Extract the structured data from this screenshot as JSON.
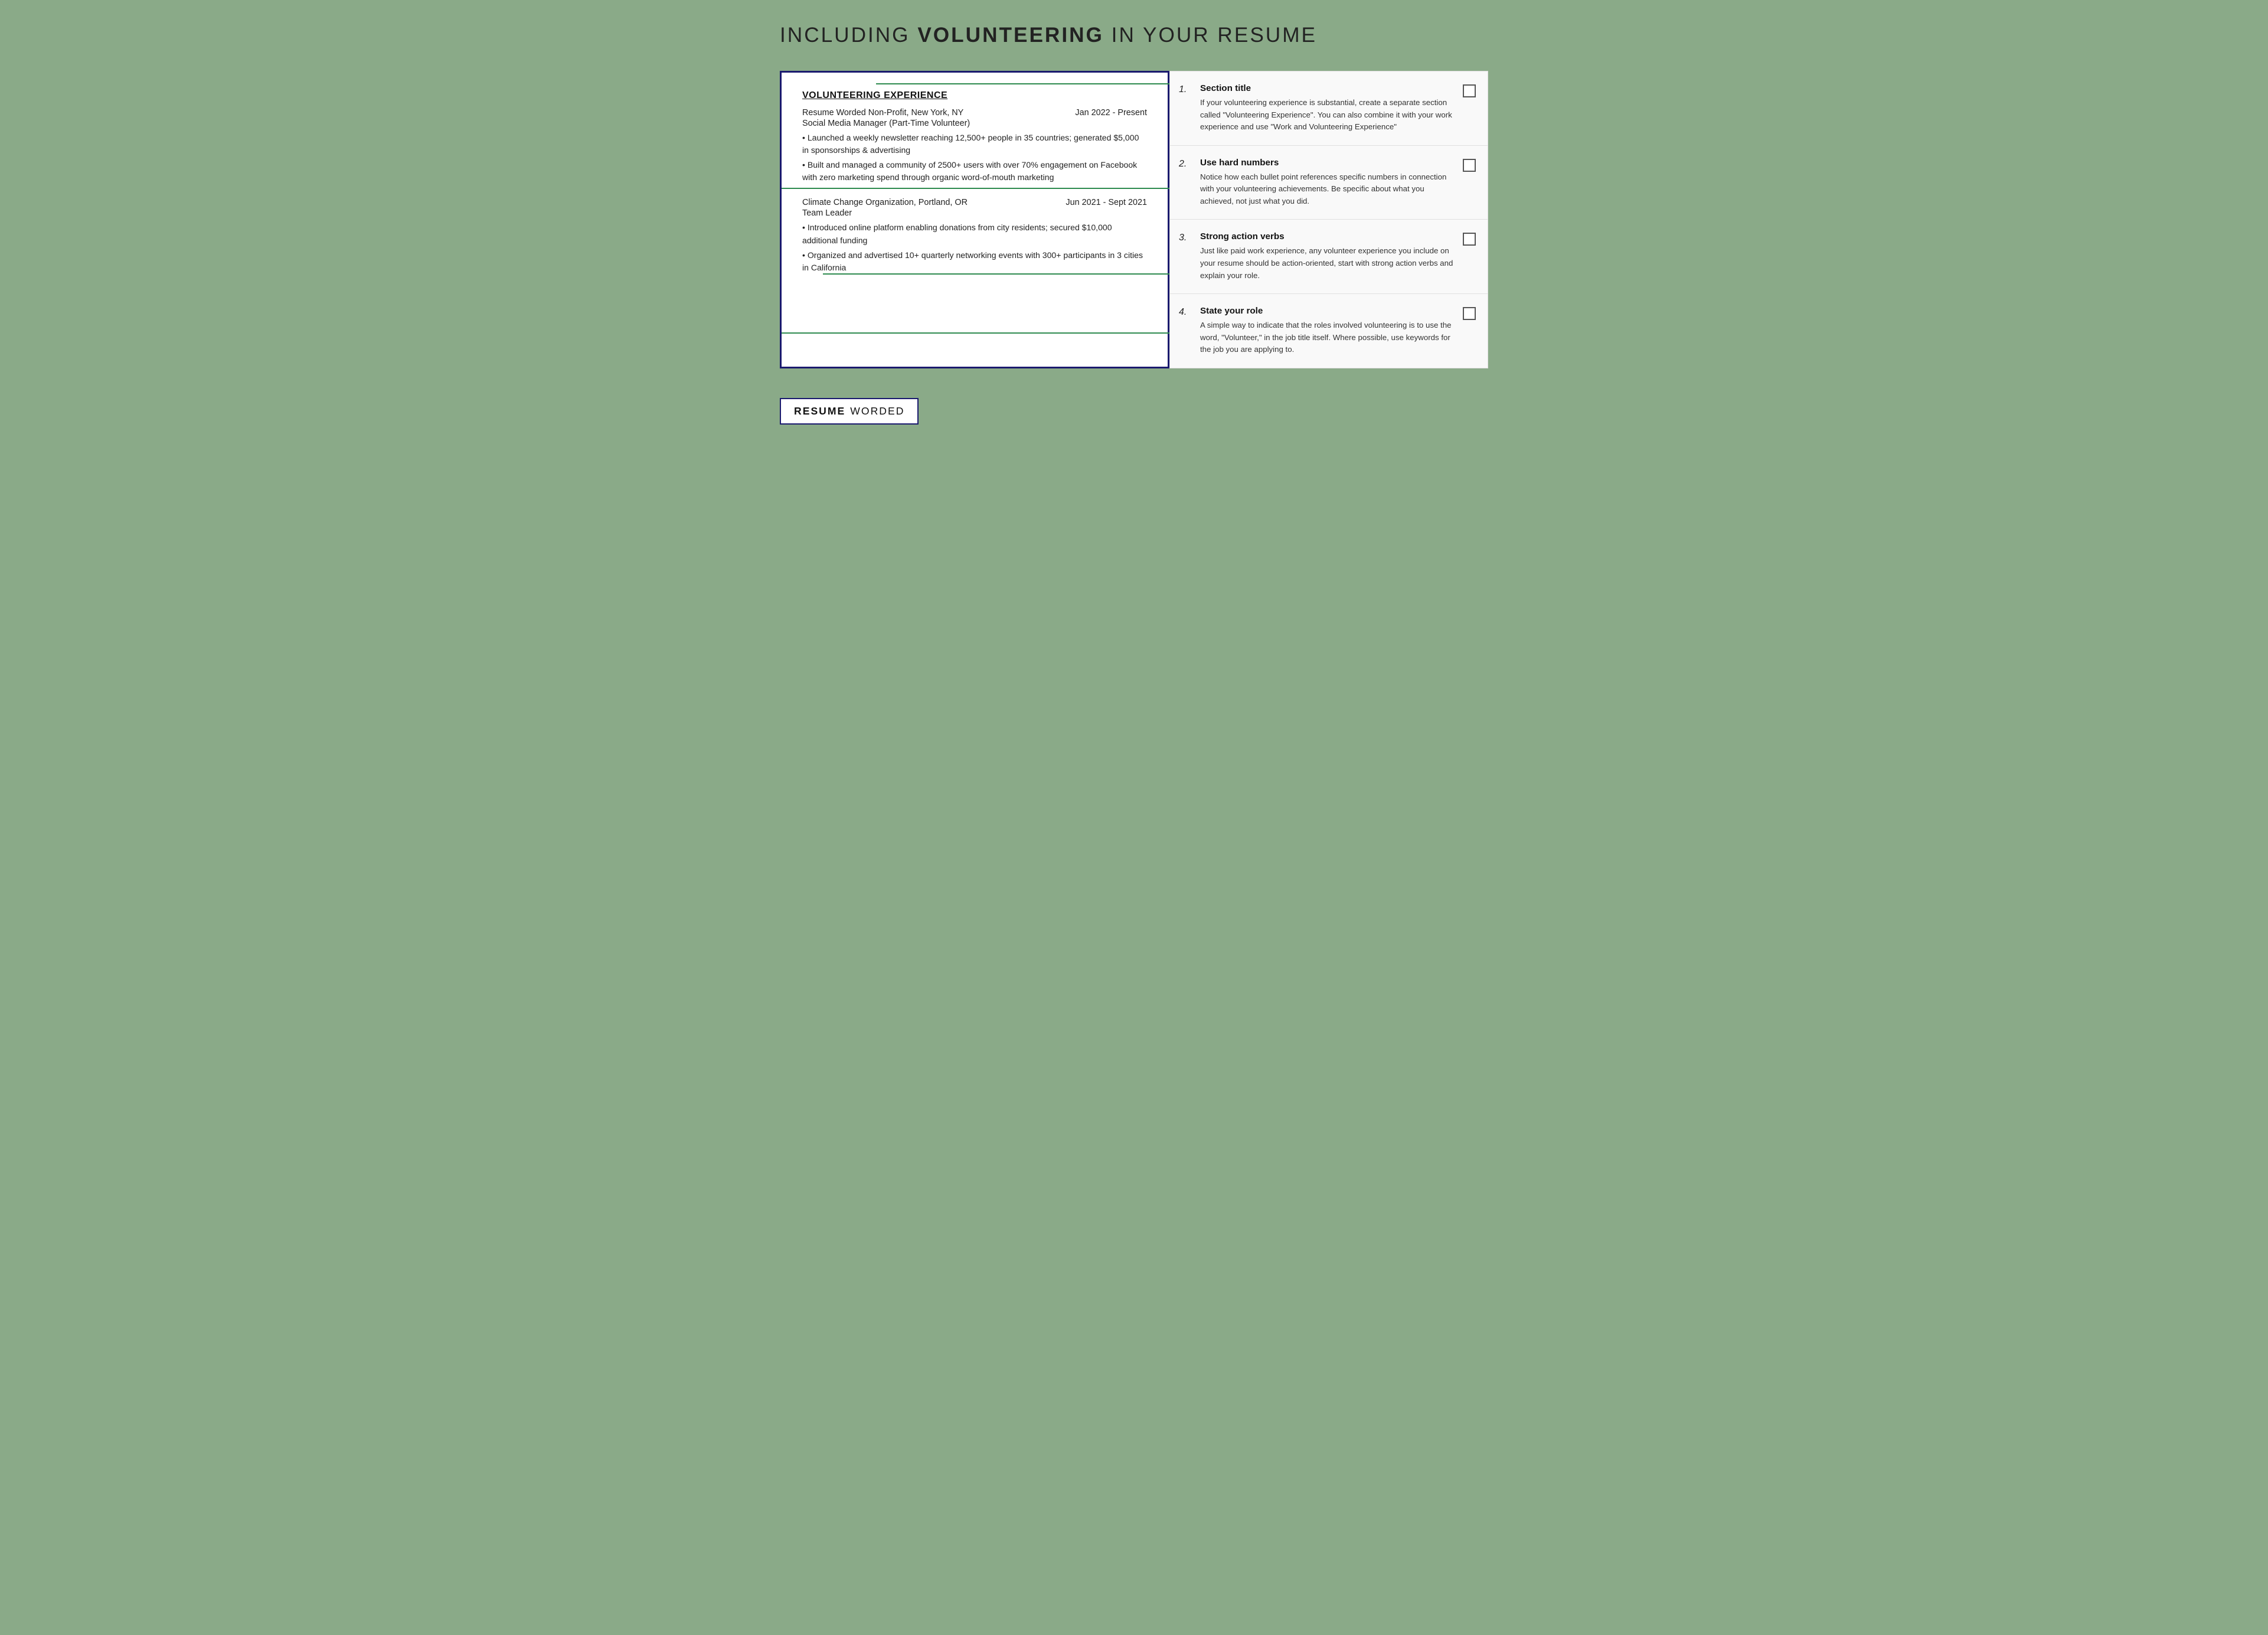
{
  "page": {
    "title_prefix": "INCLUDING ",
    "title_bold": "VOLUNTEERING",
    "title_suffix": " IN YOUR RESUME",
    "background_color": "#8aaa88"
  },
  "resume": {
    "section_title": "VOLUNTEERING EXPERIENCE",
    "jobs": [
      {
        "org": "Resume Worded Non-Profit, New York, NY",
        "date": "Jan 2022 - Present",
        "role": "Social Media Manager (Part-Time Volunteer)",
        "bullets": [
          "• Launched a weekly newsletter reaching 12,500+ people in 35 countries; generated $5,000 in sponsorships & advertising",
          "• Built and managed a community of 2500+ users with over 70% engagement on Facebook with zero marketing spend through organic word-of-mouth marketing"
        ]
      },
      {
        "org": "Climate Change Organization, Portland, OR",
        "date": "Jun 2021 - Sept 2021",
        "role": "Team Leader",
        "bullets": [
          "• Introduced online platform enabling donations from city residents; secured $10,000 additional funding",
          "• Organized and advertised 10+ quarterly networking events with 300+ participants in 3 cities in California"
        ]
      }
    ]
  },
  "tips": [
    {
      "number": "1.",
      "title": "Section title",
      "description": "If your volunteering experience is substantial, create a separate section called \"Volunteering Experience\". You can also combine it with your work experience and use \"Work and Volunteering Experience\""
    },
    {
      "number": "2.",
      "title": "Use hard numbers",
      "description": "Notice how each bullet point references specific numbers in connection with your volunteering achievements. Be specific about what you achieved, not just what you did."
    },
    {
      "number": "3.",
      "title": "Strong action verbs",
      "description": "Just like paid work experience, any volunteer experience you include on your resume should be action-oriented, start with strong action verbs and explain your role."
    },
    {
      "number": "4.",
      "title": "State your role",
      "description": "A simple way to indicate that the roles involved volunteering is to use the word, \"Volunteer,\" in the job title itself. Where possible, use keywords for the job you are applying to."
    }
  ],
  "branding": {
    "resume_label": "RESUME",
    "worded_label": "WORDED"
  }
}
